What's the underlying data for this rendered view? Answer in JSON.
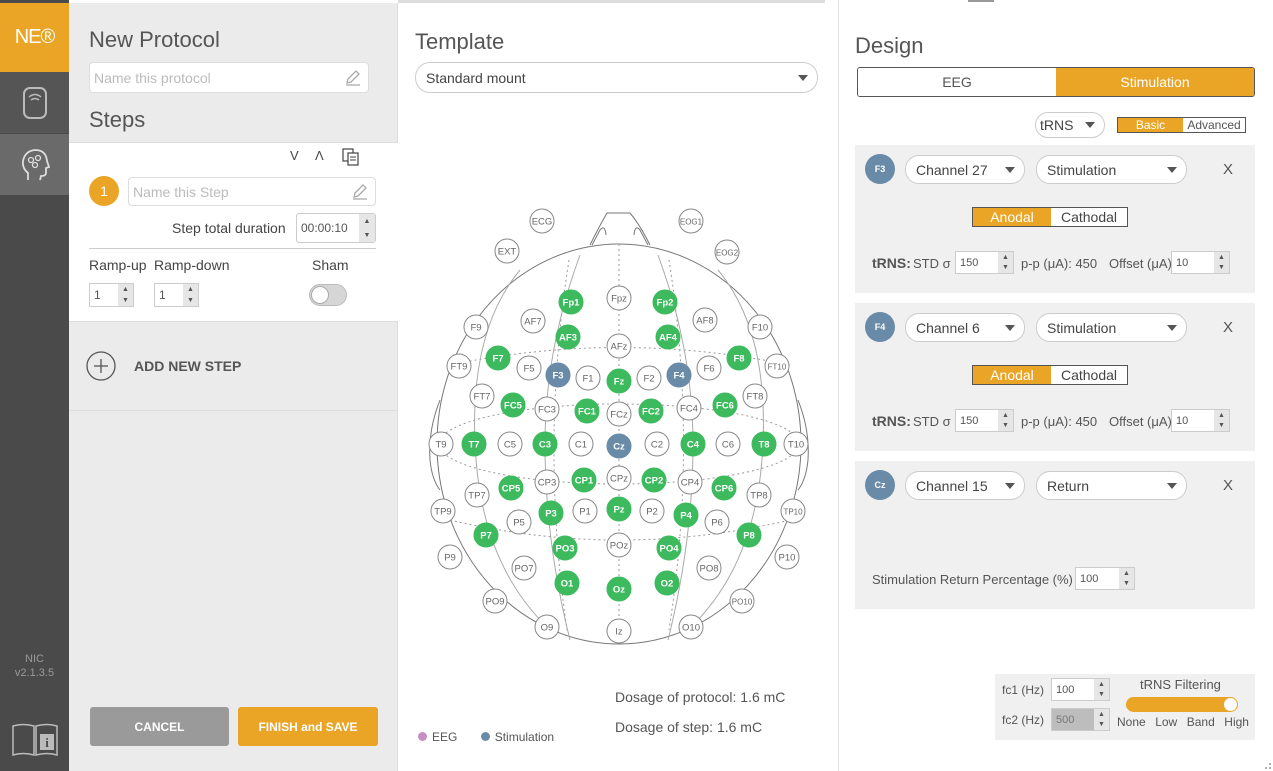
{
  "app": {
    "logo_text": "NE®",
    "version_line1": "NIC",
    "version_line2": "v2.1.3.5"
  },
  "left": {
    "title": "New Protocol",
    "name_placeholder": "Name this protocol",
    "steps_title": "Steps",
    "step_number": "1",
    "step_placeholder": "Name this Step",
    "duration_label": "Step total duration",
    "duration_value": "00:00:10",
    "rampup_label": "Ramp-up",
    "rampdown_label": "Ramp-down",
    "sham_label": "Sham",
    "rampup_value": "1",
    "rampdown_value": "1",
    "add_step": "ADD NEW STEP",
    "cancel": "CANCEL",
    "finish": "FINISH and SAVE"
  },
  "template": {
    "title": "Template",
    "select_value": "Standard mount",
    "dosage_protocol": "Dosage of protocol: 1.6 mC",
    "dosage_step": "Dosage of step: 1.6 mC",
    "legend_eeg": "EEG",
    "legend_stim": "Stimulation"
  },
  "electrodes": [
    {
      "n": "ECG",
      "s": "o"
    },
    {
      "n": "EOG1",
      "s": "o"
    },
    {
      "n": "EXT",
      "s": "o"
    },
    {
      "n": "EOG2",
      "s": "o"
    },
    {
      "n": "Fp1",
      "s": "g"
    },
    {
      "n": "Fpz",
      "s": "o"
    },
    {
      "n": "Fp2",
      "s": "g"
    },
    {
      "n": "F9",
      "s": "o"
    },
    {
      "n": "AF7",
      "s": "o"
    },
    {
      "n": "AF3",
      "s": "g"
    },
    {
      "n": "AFz",
      "s": "o"
    },
    {
      "n": "AF4",
      "s": "g"
    },
    {
      "n": "AF8",
      "s": "o"
    },
    {
      "n": "F10",
      "s": "o"
    },
    {
      "n": "F7",
      "s": "g"
    },
    {
      "n": "F5",
      "s": "o"
    },
    {
      "n": "F3",
      "s": "b"
    },
    {
      "n": "F1",
      "s": "o"
    },
    {
      "n": "Fz",
      "s": "g"
    },
    {
      "n": "F2",
      "s": "o"
    },
    {
      "n": "F4",
      "s": "b"
    },
    {
      "n": "F6",
      "s": "o"
    },
    {
      "n": "F8",
      "s": "g"
    },
    {
      "n": "FT9",
      "s": "o"
    },
    {
      "n": "FT10",
      "s": "o"
    },
    {
      "n": "FT7",
      "s": "o"
    },
    {
      "n": "FC5",
      "s": "g"
    },
    {
      "n": "FC3",
      "s": "o"
    },
    {
      "n": "FC1",
      "s": "g"
    },
    {
      "n": "FCz",
      "s": "o"
    },
    {
      "n": "FC2",
      "s": "g"
    },
    {
      "n": "FC4",
      "s": "o"
    },
    {
      "n": "FC6",
      "s": "g"
    },
    {
      "n": "FT8",
      "s": "o"
    },
    {
      "n": "T9",
      "s": "o"
    },
    {
      "n": "T7",
      "s": "g"
    },
    {
      "n": "C5",
      "s": "o"
    },
    {
      "n": "C3",
      "s": "g"
    },
    {
      "n": "C1",
      "s": "o"
    },
    {
      "n": "Cz",
      "s": "b"
    },
    {
      "n": "C2",
      "s": "o"
    },
    {
      "n": "C4",
      "s": "g"
    },
    {
      "n": "C6",
      "s": "o"
    },
    {
      "n": "T8",
      "s": "g"
    },
    {
      "n": "T10",
      "s": "o"
    },
    {
      "n": "TP7",
      "s": "o"
    },
    {
      "n": "CP5",
      "s": "g"
    },
    {
      "n": "CP3",
      "s": "o"
    },
    {
      "n": "CP1",
      "s": "g"
    },
    {
      "n": "CPz",
      "s": "o"
    },
    {
      "n": "CP2",
      "s": "g"
    },
    {
      "n": "CP4",
      "s": "o"
    },
    {
      "n": "CP6",
      "s": "g"
    },
    {
      "n": "TP8",
      "s": "o"
    },
    {
      "n": "TP9",
      "s": "o"
    },
    {
      "n": "P5",
      "s": "o"
    },
    {
      "n": "P3",
      "s": "g"
    },
    {
      "n": "P1",
      "s": "o"
    },
    {
      "n": "Pz",
      "s": "g"
    },
    {
      "n": "P2",
      "s": "o"
    },
    {
      "n": "P4",
      "s": "g"
    },
    {
      "n": "P6",
      "s": "o"
    },
    {
      "n": "TP10",
      "s": "o"
    },
    {
      "n": "P7",
      "s": "g"
    },
    {
      "n": "P8",
      "s": "g"
    },
    {
      "n": "P9",
      "s": "o"
    },
    {
      "n": "P10",
      "s": "o"
    },
    {
      "n": "PO3",
      "s": "g"
    },
    {
      "n": "POz",
      "s": "o"
    },
    {
      "n": "PO4",
      "s": "g"
    },
    {
      "n": "PO7",
      "s": "o"
    },
    {
      "n": "PO8",
      "s": "o"
    },
    {
      "n": "PO9",
      "s": "o"
    },
    {
      "n": "O1",
      "s": "g"
    },
    {
      "n": "Oz",
      "s": "g"
    },
    {
      "n": "O2",
      "s": "g"
    },
    {
      "n": "PO10",
      "s": "o"
    },
    {
      "n": "O9",
      "s": "o"
    },
    {
      "n": "Iz",
      "s": "o"
    },
    {
      "n": "O10",
      "s": "o"
    }
  ],
  "design": {
    "title": "Design",
    "tab_eeg": "EEG",
    "tab_stim": "Stimulation",
    "mode": "tRNS",
    "basic": "Basic",
    "advanced": "Advanced",
    "cards": [
      {
        "chip": "F3",
        "channel": "Channel 27",
        "type": "Stimulation",
        "anodal": "Anodal",
        "cathodal": "Cathodal",
        "trns": "tRNS:",
        "std": "STD σ",
        "std_val": "150",
        "pp": "p-p (μA): 450",
        "offset": "Offset (μA)",
        "offset_val": "10",
        "x": "X"
      },
      {
        "chip": "F4",
        "channel": "Channel 6",
        "type": "Stimulation",
        "anodal": "Anodal",
        "cathodal": "Cathodal",
        "trns": "tRNS:",
        "std": "STD σ",
        "std_val": "150",
        "pp": "p-p (μA): 450",
        "offset": "Offset (μA)",
        "offset_val": "10",
        "x": "X"
      },
      {
        "chip": "Cz",
        "channel": "Channel 15",
        "type": "Return",
        "return_label": "Stimulation Return Percentage (%)",
        "return_val": "100",
        "x": "X"
      }
    ],
    "filter": {
      "fc1_label": "fc1 (Hz)",
      "fc1_val": "100",
      "fc2_label": "fc2 (Hz)",
      "fc2_val": "500",
      "title": "tRNS Filtering",
      "opts": [
        "None",
        "Low",
        "Band",
        "High"
      ],
      "selected": "High"
    }
  },
  "colors": {
    "accent": "#eaa527",
    "green": "#3dba5e",
    "blue": "#6a8ba8",
    "eeg": "#c58fc4"
  }
}
